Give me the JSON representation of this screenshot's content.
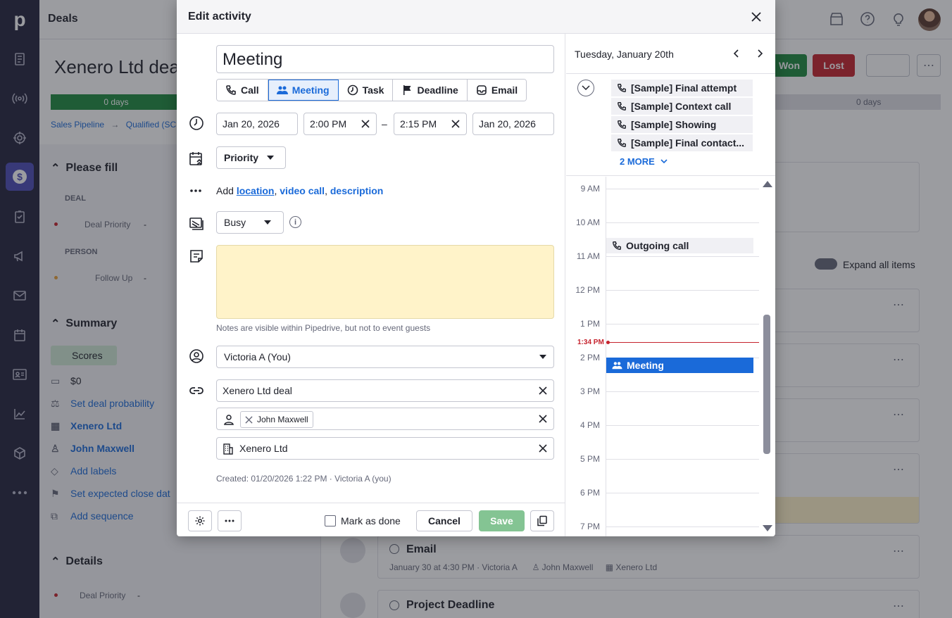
{
  "app": {
    "logo": "p",
    "section_title": "Deals",
    "deal_title": "Xenero Ltd deal",
    "won_label": "Won",
    "lost_label": "Lost",
    "stage_first": "0 days",
    "stage_last": "0 days",
    "breadcrumb": [
      "Sales Pipeline",
      "→",
      "Qualified (SC"
    ]
  },
  "sidebar": {
    "please_fill": "Please fill",
    "deal_label": "DEAL",
    "deal_priority_label": "Deal Priority",
    "deal_priority_value": "-",
    "person_label": "PERSON",
    "follow_up_label": "Follow Up",
    "follow_up_value": "-",
    "summary_title": "Summary",
    "scores_label": "Scores",
    "value": "$0",
    "set_probability": "Set deal probability",
    "org_name": "Xenero Ltd",
    "person_name": "John Maxwell",
    "add_labels": "Add labels",
    "set_close_date": "Set expected close dat",
    "add_sequence": "Add sequence",
    "details_title": "Details",
    "details_priority_label": "Deal Priority",
    "details_priority_value": "-"
  },
  "feed": {
    "expand_all": "Expand all items",
    "email_title": "Email",
    "email_meta": "January 30 at 4:30 PM · Victoria A",
    "email_person": "John Maxwell",
    "email_org": "Xenero Ltd",
    "deadline_title": "Project Deadline"
  },
  "modal": {
    "title": "Edit activity",
    "subject": "Meeting",
    "types": [
      {
        "label": "Call",
        "icon": "phone-icon"
      },
      {
        "label": "Meeting",
        "icon": "people-icon"
      },
      {
        "label": "Task",
        "icon": "clock-icon"
      },
      {
        "label": "Deadline",
        "icon": "flag-icon"
      },
      {
        "label": "Email",
        "icon": "mail-icon"
      }
    ],
    "start_date": "Jan 20, 2026",
    "start_time": "2:00 PM",
    "dash": "–",
    "end_time": "2:15 PM",
    "end_date": "Jan 20, 2026",
    "priority": "Priority",
    "add_prefix": "Add",
    "add_location": "location",
    "add_video": "video call",
    "add_description": "description",
    "comma": ",",
    "busy": "Busy",
    "notes_hint": "Notes are visible within Pipedrive, but not to event guests",
    "owner": "Victoria A (You)",
    "deal": "Xenero Ltd deal",
    "person_chip": "John Maxwell",
    "organization": "Xenero Ltd",
    "created": "Created: 01/20/2026 1:22 PM · Victoria A (you)",
    "mark_done": "Mark as done",
    "cancel": "Cancel",
    "save": "Save"
  },
  "calendar": {
    "date": "Tuesday, January 20th",
    "all_day": [
      "[Sample] Final attempt",
      "[Sample] Context call",
      "[Sample] Showing",
      "[Sample] Final contact..."
    ],
    "more": "2 MORE",
    "hours": [
      "9 AM",
      "10 AM",
      "11 AM",
      "12 PM",
      "1 PM",
      "2 PM",
      "3 PM",
      "4 PM",
      "5 PM",
      "6 PM",
      "7 PM"
    ],
    "now_label": "1:34 PM",
    "event_call": "Outgoing call",
    "event_meeting": "Meeting",
    "colors": {
      "meeting": "#1a6ad9",
      "call_bg": "#f0f0f4",
      "now": "#c5232d"
    }
  }
}
